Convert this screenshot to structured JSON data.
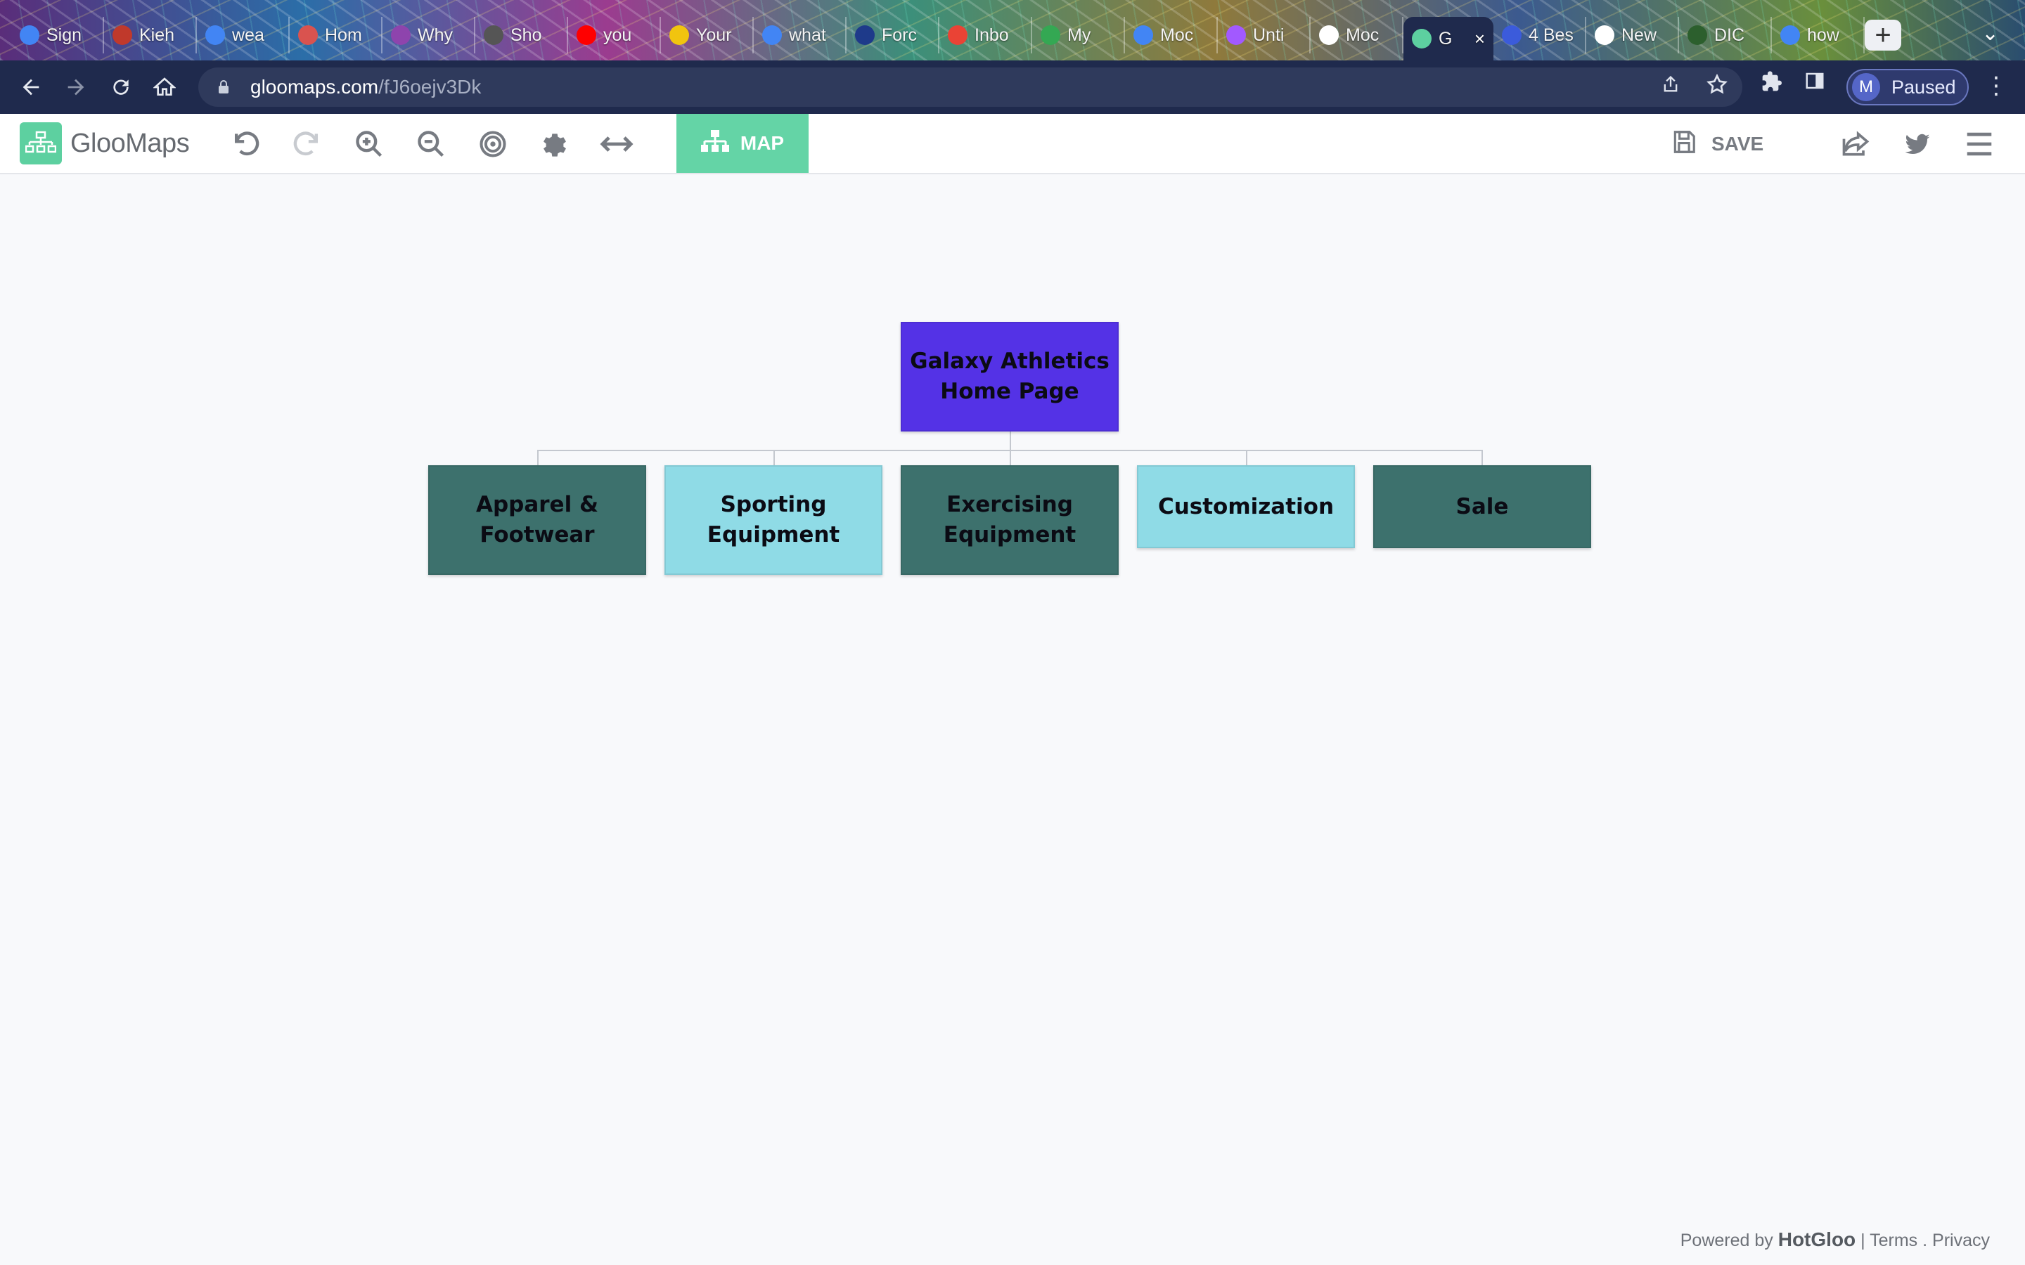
{
  "browser": {
    "tabs": [
      {
        "label": "Sign",
        "icon": "google-icon",
        "color": "#4285f4"
      },
      {
        "label": "Kieh",
        "icon": "kiehls-icon",
        "color": "#c0392b"
      },
      {
        "label": "wea",
        "icon": "google-icon",
        "color": "#4285f4"
      },
      {
        "label": "Hom",
        "icon": "home-app-icon",
        "color": "#d9534f"
      },
      {
        "label": "Why",
        "icon": "swirl-icon",
        "color": "#8e44ad"
      },
      {
        "label": "Sho",
        "icon": "settings-gear-icon",
        "color": "#555555"
      },
      {
        "label": "you",
        "icon": "youtube-icon",
        "color": "#ff0000"
      },
      {
        "label": "Your",
        "icon": "crown-icon",
        "color": "#f1c40f"
      },
      {
        "label": "what",
        "icon": "google-icon",
        "color": "#4285f4"
      },
      {
        "label": "Forc",
        "icon": "shield-icon",
        "color": "#1e3a8a"
      },
      {
        "label": "Inbo",
        "icon": "gmail-icon",
        "color": "#ea4335"
      },
      {
        "label": "My",
        "icon": "drive-icon",
        "color": "#34a853"
      },
      {
        "label": "Moc",
        "icon": "docs-icon",
        "color": "#4285f4"
      },
      {
        "label": "Unti",
        "icon": "figma-icon",
        "color": "#a259ff"
      },
      {
        "label": "Moc",
        "icon": "github-icon",
        "color": "#ffffff"
      },
      {
        "label": "G",
        "icon": "gloomaps-icon",
        "color": "#5dd0a0",
        "active": true
      },
      {
        "label": "4 Bes",
        "icon": "circle-4-icon",
        "color": "#3b5bdb"
      },
      {
        "label": "New",
        "icon": "openai-icon",
        "color": "#ffffff"
      },
      {
        "label": "DIC",
        "icon": "dictionary-icon",
        "color": "#2c5f2d"
      },
      {
        "label": "how",
        "icon": "google-icon",
        "color": "#4285f4"
      }
    ],
    "url_domain": "gloomaps.com",
    "url_path": "/fJ6oejv3Dk",
    "profile_initial": "M",
    "profile_status": "Paused"
  },
  "toolbar": {
    "app_name": "GlooMaps",
    "map_label": "MAP",
    "save_label": "SAVE"
  },
  "sitemap": {
    "root": {
      "label_line1": "Galaxy Athletics",
      "label_line2": "Home Page",
      "color": "#5432e6"
    },
    "children": [
      {
        "label_line1": "Apparel &",
        "label_line2": "Footwear",
        "color": "#3d716d"
      },
      {
        "label_line1": "Sporting",
        "label_line2": "Equipment",
        "color": "#8fdbe6"
      },
      {
        "label_line1": "Exercising",
        "label_line2": "Equipment",
        "color": "#3d716d"
      },
      {
        "label_line1": "Customization",
        "label_line2": "",
        "color": "#8fdbe6"
      },
      {
        "label_line1": "Sale",
        "label_line2": "",
        "color": "#3d716d"
      }
    ]
  },
  "footer": {
    "powered_by": "Powered by",
    "brand": "HotGloo",
    "separator": "|",
    "terms": "Terms",
    "dot": ".",
    "privacy": "Privacy"
  }
}
